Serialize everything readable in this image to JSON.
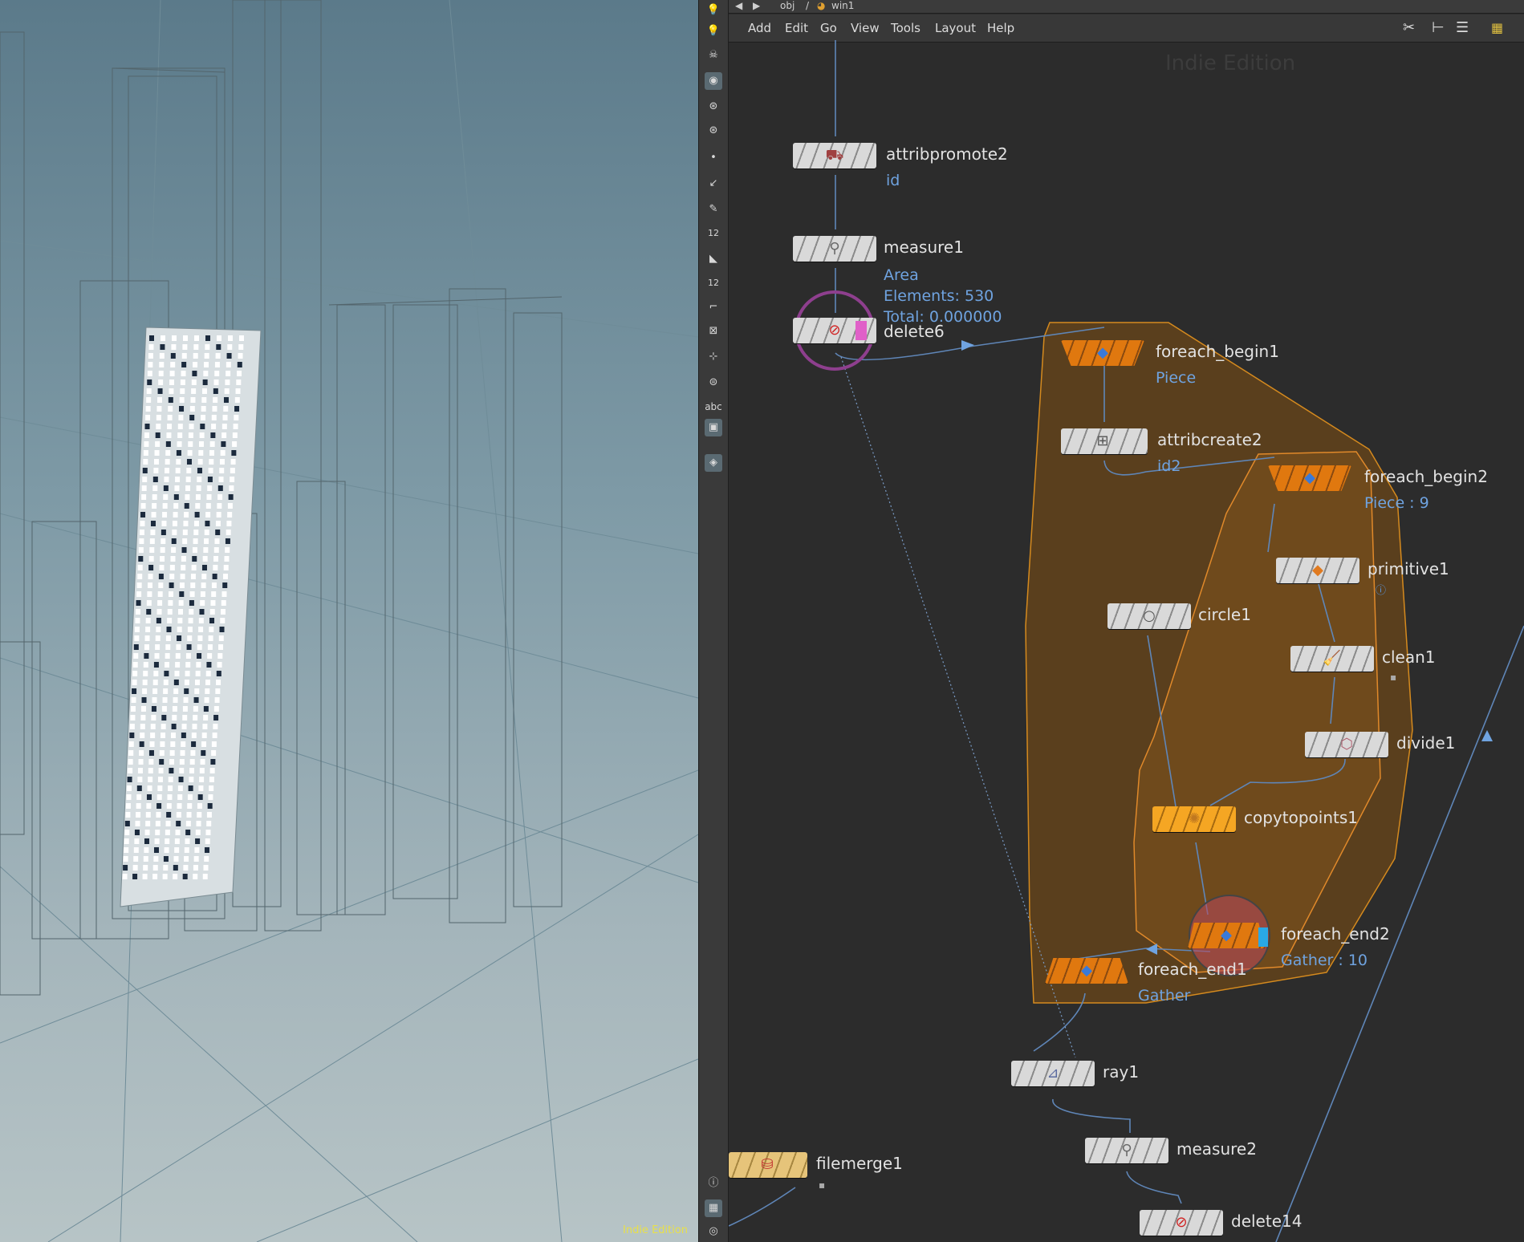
{
  "viewport": {
    "watermark": "Indie Edition"
  },
  "toolbar": {
    "tools": [
      "bulb-icon",
      "skull-icon",
      "camera-icon",
      "eye-icon",
      "snapshot-icon",
      "point-icon",
      "pen-icon",
      "brush-icon",
      "number-icon",
      "bucket-icon",
      "number2-icon",
      "curve-icon",
      "grid-icon",
      "stamp-icon",
      "stack-icon",
      "abc-icon",
      "image-icon",
      "pin-icon",
      "info-icon",
      "layout-icon",
      "visibility-icon"
    ],
    "abc_label": "abc",
    "label_12a": "12",
    "label_12b": "12"
  },
  "network": {
    "path": {
      "obj": "obj",
      "sep": "/",
      "node": "win1"
    },
    "menu": [
      "Add",
      "Edit",
      "Go",
      "View",
      "Tools",
      "Layout",
      "Help"
    ],
    "watermark": "Indie Edition",
    "nodes": {
      "attribpromote2": {
        "name": "attribpromote2",
        "sub": "id"
      },
      "measure1": {
        "name": "measure1",
        "sub1": "Area",
        "sub2": "Elements: 530",
        "sub3": "Total: 0.000000"
      },
      "delete6": {
        "name": "delete6"
      },
      "foreach_begin1": {
        "name": "foreach_begin1",
        "sub": "Piece"
      },
      "attribcreate2": {
        "name": "attribcreate2",
        "sub": "id2"
      },
      "foreach_begin2": {
        "name": "foreach_begin2",
        "sub": "Piece : 9"
      },
      "primitive1": {
        "name": "primitive1"
      },
      "circle1": {
        "name": "circle1"
      },
      "clean1": {
        "name": "clean1"
      },
      "divide1": {
        "name": "divide1"
      },
      "copytopoints1": {
        "name": "copytopoints1"
      },
      "foreach_end2": {
        "name": "foreach_end2",
        "sub": "Gather : 10"
      },
      "foreach_end1": {
        "name": "foreach_end1",
        "sub": "Gather"
      },
      "ray1": {
        "name": "ray1"
      },
      "measure2": {
        "name": "measure2"
      },
      "filemerge1": {
        "name": "filemerge1"
      },
      "delete14": {
        "name": "delete14"
      }
    }
  }
}
